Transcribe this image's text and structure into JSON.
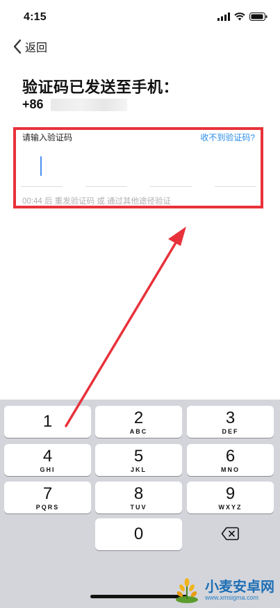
{
  "status_bar": {
    "time": "4:15"
  },
  "nav": {
    "back_label": "返回"
  },
  "page": {
    "title": "验证码已发送至手机：",
    "phone_prefix": "+86"
  },
  "code_input": {
    "label": "请输入验证码",
    "no_code_link": "收不到验证码?",
    "resend_text": "00:44 后 重发验证码 或 通过其他途径验证"
  },
  "keyboard": {
    "keys": [
      {
        "digit": "1",
        "letters": ""
      },
      {
        "digit": "2",
        "letters": "ABC"
      },
      {
        "digit": "3",
        "letters": "DEF"
      },
      {
        "digit": "4",
        "letters": "GHI"
      },
      {
        "digit": "5",
        "letters": "JKL"
      },
      {
        "digit": "6",
        "letters": "MNO"
      },
      {
        "digit": "7",
        "letters": "PQRS"
      },
      {
        "digit": "8",
        "letters": "TUV"
      },
      {
        "digit": "9",
        "letters": "WXYZ"
      },
      {
        "digit": "0",
        "letters": ""
      }
    ]
  },
  "watermark": {
    "title": "小麦安卓网",
    "url": "www.xmsigma.com"
  },
  "colors": {
    "highlight": "#e8323b",
    "link": "#2a8de9",
    "keyboard_bg": "#d3d5db"
  }
}
